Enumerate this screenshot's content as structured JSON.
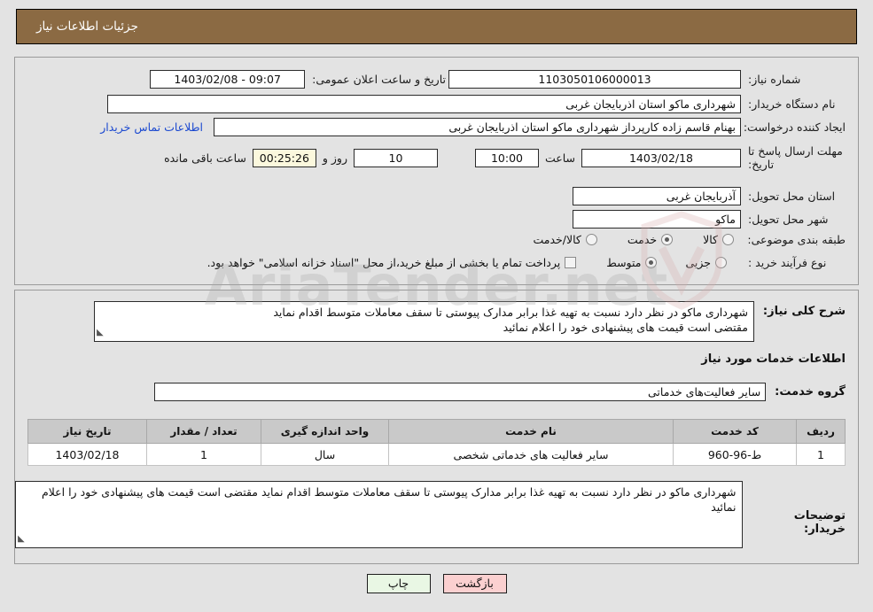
{
  "header": {
    "title": "جزئیات اطلاعات نیاز"
  },
  "colors": {
    "header_bar": "#8b6a43",
    "page_bg": "#e3e3e3",
    "link": "#1b49d0",
    "countdown_bg": "#fbf8dd",
    "back_button_bg": "#fbd0d0",
    "print_button_bg": "#e9f7e4",
    "table_header_bg": "#c9c9c9"
  },
  "watermark": {
    "text": "AriaTender.net"
  },
  "form": {
    "need_number": {
      "label": "شماره نیاز:",
      "value": "1103050106000013"
    },
    "announce_datetime": {
      "label": "تاریخ و ساعت اعلان عمومی:",
      "value": "1403/02/08 - 09:07"
    },
    "buyer_org": {
      "label": "نام دستگاه خریدار:",
      "value": "شهرداری ماکو استان اذربایجان غربی"
    },
    "requester": {
      "label": "ایجاد کننده درخواست:",
      "value": "بهنام قاسم زاده کارپرداز شهرداری ماکو استان اذربایجان غربی"
    },
    "contact_link": {
      "label": "اطلاعات تماس خریدار"
    },
    "deadline": {
      "label": "مهلت ارسال پاسخ تا تاریخ:",
      "date": "1403/02/18",
      "hour_label": "ساعت",
      "time": "10:00",
      "days": "10",
      "days_label": "روز و",
      "countdown": "00:25:26",
      "remaining_label": "ساعت باقی مانده"
    },
    "province": {
      "label": "استان محل تحویل:",
      "value": "آذربایجان غربی"
    },
    "city": {
      "label": "شهر محل تحویل:",
      "value": "ماکو"
    },
    "category": {
      "label": "طبقه بندی موضوعی:",
      "options": [
        {
          "label": "کالا",
          "selected": false
        },
        {
          "label": "خدمت",
          "selected": true
        },
        {
          "label": "کالا/خدمت",
          "selected": false
        }
      ]
    },
    "process_type": {
      "label": "نوع فرآیند خرید :",
      "options": [
        {
          "label": "جزیی",
          "selected": false
        },
        {
          "label": "متوسط",
          "selected": true
        }
      ],
      "checkbox_label": "پرداخت تمام یا بخشی از مبلغ خرید،از محل \"اسناد خزانه اسلامی\" خواهد بود.",
      "checkbox_checked": false
    }
  },
  "need_description": {
    "label": "شرح کلی نیاز:",
    "value": "شهرداری ماکو در نظر دارد نسبت به تهیه غذا برابر مدارک پیوستی تا سقف معاملات متوسط اقدام نماید\nمقتضی است قیمت های پیشنهادی خود را اعلام نمائید"
  },
  "services_section": {
    "heading": "اطلاعات خدمات مورد نیاز",
    "service_group": {
      "label": "گروه خدمت:",
      "value": "سایر فعالیت‌های خدماتی"
    },
    "table": {
      "columns": [
        "ردیف",
        "کد خدمت",
        "نام خدمت",
        "واحد اندازه گیری",
        "تعداد / مقدار",
        "تاریخ نیاز"
      ],
      "rows": [
        {
          "row_no": "1",
          "service_code": "ط-96-960",
          "service_name": "سایر فعالیت های خدماتی شخصی",
          "unit": "سال",
          "quantity": "1",
          "need_date": "1403/02/18"
        }
      ]
    }
  },
  "buyer_notes": {
    "label": "توضیحات خریدار:",
    "value": "شهرداری ماکو در نظر دارد نسبت به تهیه غذا برابر مدارک پیوستی تا سقف معاملات متوسط اقدام نماید مقتضی است قیمت های پیشنهادی خود را اعلام نمائید"
  },
  "buttons": {
    "back": "بازگشت",
    "print": "چاپ"
  }
}
